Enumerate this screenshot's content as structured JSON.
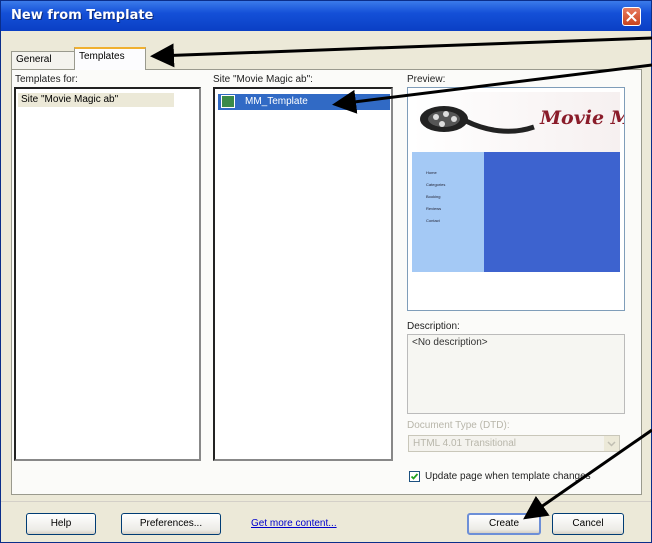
{
  "window": {
    "title": "New from Template",
    "close_icon": "close-icon"
  },
  "tabs": [
    {
      "label": "General",
      "active": false
    },
    {
      "label": "Templates",
      "active": true
    }
  ],
  "templates_for": {
    "label": "Templates for:",
    "items": [
      "Site \"Movie Magic ab\""
    ]
  },
  "site_list": {
    "label": "Site \"Movie Magic ab\":",
    "items": [
      "MM_Template"
    ],
    "item_icon": "template-file-icon"
  },
  "preview": {
    "label": "Preview:",
    "banner_text": "Movie M",
    "banner_icon": "film-reel-icon",
    "nav_links": [
      "Home",
      "Categories",
      "Booking",
      "Reviews",
      "Contact"
    ]
  },
  "description": {
    "label": "Description:",
    "text": "<No description>"
  },
  "doctype": {
    "label": "Document Type (DTD):",
    "value": "HTML 4.01 Transitional",
    "disabled": true
  },
  "update_checkbox": {
    "label": "Update page when template changes",
    "checked": true
  },
  "footer": {
    "help": "Help",
    "preferences": "Preferences...",
    "more_content": "Get more content...",
    "create": "Create",
    "cancel": "Cancel"
  },
  "colors": {
    "titlebar": "#0a3fc4",
    "selection": "#316ac5",
    "preview_content": "#3d63cf",
    "preview_nav": "#a4c9f5",
    "banner_text": "#8a1c2a"
  }
}
